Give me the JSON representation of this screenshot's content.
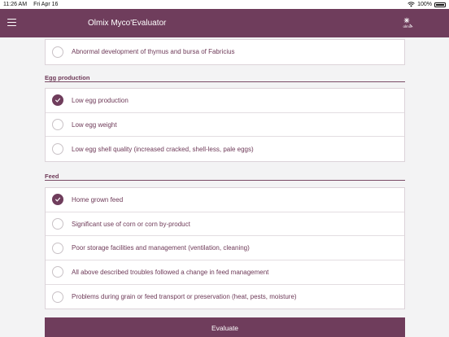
{
  "status_bar": {
    "time": "11:26 AM",
    "date": "Fri Apr 16",
    "battery": "100%"
  },
  "app_bar": {
    "title": "Olmix Myco'Evaluator",
    "logo_text": "olmix"
  },
  "top_card": {
    "items": [
      {
        "label": "Abnormal development of thymus and bursa of Fabricius",
        "checked": false
      }
    ]
  },
  "egg_production": {
    "title": "Egg production",
    "items": [
      {
        "label": "Low egg production",
        "checked": true
      },
      {
        "label": "Low egg weight",
        "checked": false
      },
      {
        "label": "Low egg shell quality (increased cracked, shell-less, pale eggs)",
        "checked": false
      }
    ]
  },
  "feed": {
    "title": "Feed",
    "items": [
      {
        "label": "Home grown feed",
        "checked": true
      },
      {
        "label": "Significant use of corn or corn by-product",
        "checked": false
      },
      {
        "label": "Poor storage facilities and management (ventilation, cleaning)",
        "checked": false
      },
      {
        "label": "All above described troubles followed a change in feed management",
        "checked": false
      },
      {
        "label": "Problems during grain or feed transport or preservation (heat, pests, moisture)",
        "checked": false
      }
    ]
  },
  "evaluate_label": "Evaluate",
  "colors": {
    "primary": "#6f3d5c",
    "text": "#6e3a58",
    "background": "#f3f3f4"
  }
}
